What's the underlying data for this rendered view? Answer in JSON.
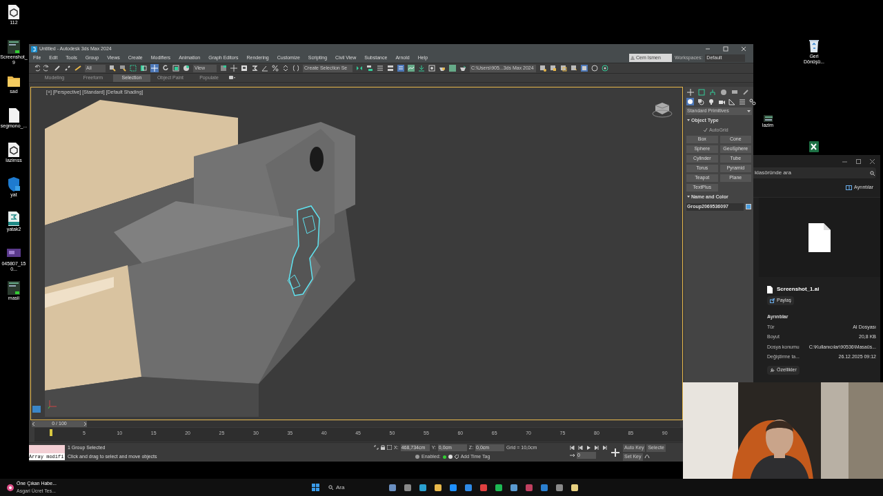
{
  "desktop_icons": [
    {
      "label": "112",
      "kind": "cube"
    },
    {
      "label": "Screenshot_9",
      "kind": "thumb"
    },
    {
      "label": "sad",
      "kind": "folder"
    },
    {
      "label": "segmono_...",
      "kind": "file"
    },
    {
      "label": "lazimss",
      "kind": "cube"
    },
    {
      "label": "yat",
      "kind": "shield"
    },
    {
      "label": "yatak2",
      "kind": "max"
    },
    {
      "label": "045807_150...",
      "kind": "video"
    },
    {
      "label": "masii",
      "kind": "thumb"
    }
  ],
  "desktop_right_icons": [
    {
      "label": "Geri Dönüşü...",
      "kind": "bin"
    },
    {
      "label": "lazim",
      "kind": "thumb"
    }
  ],
  "max_window": {
    "title": "Untitled - Autodesk 3ds Max 2024",
    "menu": [
      "File",
      "Edit",
      "Tools",
      "Group",
      "Views",
      "Create",
      "Modifiers",
      "Animation",
      "Graph Editors",
      "Rendering",
      "Customize",
      "Scripting",
      "Civil View",
      "Substance",
      "Arnold",
      "Help"
    ],
    "toolbar": {
      "selection_filter": "All",
      "ref_coord": "View",
      "named_selection": "Create Selection Se",
      "project_path": "C:\\Users\\905...3ds Max 2024",
      "user": "Cem Ismen",
      "workspaces_label": "Workspaces:",
      "workspace": "Default"
    },
    "ribbon_tabs": [
      {
        "label": "Modeling",
        "selected": false
      },
      {
        "label": "Freeform",
        "selected": false
      },
      {
        "label": "Selection",
        "selected": true
      },
      {
        "label": "Object Paint",
        "selected": false
      },
      {
        "label": "Populate",
        "selected": false
      }
    ],
    "viewport": {
      "label": "[+] [Perspective] [Standard] [Default Shading]"
    },
    "command_panel": {
      "category": "Standard Primitives",
      "object_type": "Object Type",
      "autogrid": {
        "label": "AutoGrid",
        "checked": true,
        "disabled": true
      },
      "buttons": [
        "Box",
        "Cone",
        "Sphere",
        "GeoSphere",
        "Cylinder",
        "Tube",
        "Torus",
        "Pyramid",
        "Teapot",
        "Plane",
        "TextPlus"
      ],
      "name_and_color": "Name and Color",
      "object_name": "Group2069536097"
    },
    "timeline": {
      "slider": "0 / 100",
      "ticks": [
        "5",
        "10",
        "15",
        "20",
        "25",
        "30",
        "35",
        "40",
        "45",
        "50",
        "55",
        "60",
        "65",
        "70",
        "75",
        "80",
        "85",
        "90"
      ]
    },
    "status": {
      "script_field": "Array modifi",
      "selected": "1 Group Selected",
      "prompt": "Click and drag to select and move objects",
      "coordinates": [
        {
          "axis": "X:",
          "value": "468,734cm"
        },
        {
          "axis": "Y:",
          "value": "0,0cm"
        },
        {
          "axis": "Z:",
          "value": "0,0cm"
        }
      ],
      "grid": "Grid = 10,0cm",
      "enabled": "Enabled:",
      "add_time_tag": "Add Time Tag",
      "frame": "0",
      "auto_key": "Auto Key",
      "set_key": "Set Key",
      "selected_btn": "Selecte"
    }
  },
  "explorer": {
    "search_placeholder": "klasöründe ara",
    "details_button": "Ayrıntılar",
    "file_name": "Screenshot_1.ai",
    "share": "Paylaş",
    "details_heading": "Ayrıntılar",
    "details": [
      {
        "label": "Tür",
        "value": "AI Dosyası"
      },
      {
        "label": "Boyut",
        "value": "20,8 KB"
      },
      {
        "label": "Dosya konumu",
        "value": "C:\\Kullanıcılar\\90536\\Masaüs..."
      },
      {
        "label": "Değiştirme ta...",
        "value": "26.12.2025 09:12"
      }
    ],
    "properties": "Özellikler"
  },
  "taskbar": {
    "news_title": "Öne Çıkan Habe...",
    "news_subtitle": "Asgari Ücret Tes...",
    "search": "Ara"
  }
}
